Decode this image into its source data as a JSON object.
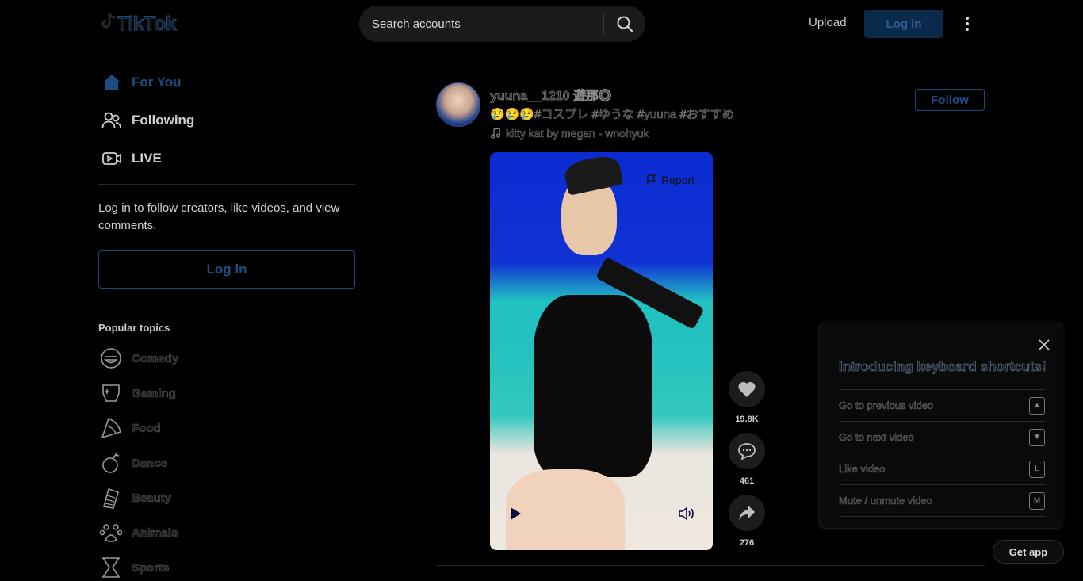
{
  "header": {
    "logo_text": "TikTok",
    "search_placeholder": "Search accounts",
    "upload_label": "Upload",
    "login_label": "Log in"
  },
  "sidebar": {
    "nav": [
      {
        "label": "For You",
        "icon": "home-icon"
      },
      {
        "label": "Following",
        "icon": "users-icon"
      },
      {
        "label": "LIVE",
        "icon": "live-icon"
      }
    ],
    "login_prompt": "Log in to follow creators, like videos, and view comments.",
    "login_button": "Log in",
    "topics_title": "Popular topics",
    "topics": [
      {
        "label": "Comedy",
        "icon": "comedy-icon"
      },
      {
        "label": "Gaming",
        "icon": "gaming-icon"
      },
      {
        "label": "Food",
        "icon": "food-icon"
      },
      {
        "label": "Dance",
        "icon": "dance-icon"
      },
      {
        "label": "Beauty",
        "icon": "beauty-icon"
      },
      {
        "label": "Animals",
        "icon": "animals-icon"
      },
      {
        "label": "Sports",
        "icon": "sports-icon"
      }
    ]
  },
  "post": {
    "author": "yuuna__1210 遊那◎",
    "description": "😢😢😢#コスプレ #ゆうな #yuuna #おすすめ",
    "music": "kitty kat by megan - wnohyuk",
    "follow_label": "Follow",
    "report_label": "Report",
    "likes": "19.8K",
    "comments": "461",
    "shares": "276"
  },
  "shortcuts": {
    "title": "Introducing keyboard shortcuts!",
    "items": [
      {
        "label": "Go to previous video",
        "key": "▲"
      },
      {
        "label": "Go to next video",
        "key": "▼"
      },
      {
        "label": "Like video",
        "key": "L"
      },
      {
        "label": "Mute / unmute video",
        "key": "M"
      }
    ]
  },
  "get_app_label": "Get app",
  "colors": {
    "accent": "#1b4d80",
    "background": "#000000",
    "video_blue": "#0a2bd1",
    "video_teal": "#23d1c0"
  }
}
